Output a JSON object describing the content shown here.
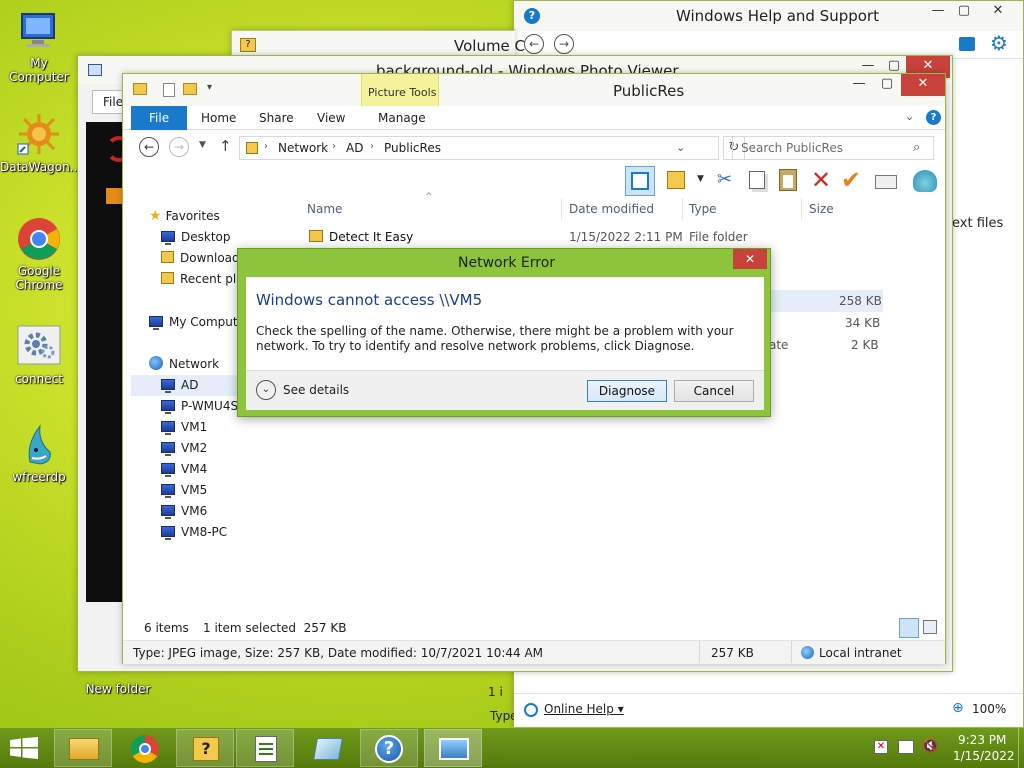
{
  "desktop": {
    "icons": [
      {
        "label": "My Computer"
      },
      {
        "label": "DataWagon..."
      },
      {
        "label": "Google Chrome"
      },
      {
        "label": "connect"
      },
      {
        "label": "wfreerdp"
      },
      {
        "label": "New folder"
      }
    ]
  },
  "help_window": {
    "title": "Windows Help and Support",
    "online_help": "Online Help",
    "zoom": "100%",
    "partial_text": "ext files",
    "partial_type": "Type",
    "partial_one": "1 i"
  },
  "volume_window": {
    "title": "Volume C"
  },
  "photo_viewer": {
    "title": "background-old - Windows Photo Viewer",
    "file_tab": "File"
  },
  "explorer": {
    "title": "PublicRes",
    "contextual_group": "Picture Tools",
    "ribbon_tabs": [
      "File",
      "Home",
      "Share",
      "View",
      "Manage"
    ],
    "breadcrumb": [
      "Network",
      "AD",
      "PublicRes"
    ],
    "search_placeholder": "Search PublicRes",
    "nav": {
      "favorites": "Favorites",
      "favorites_items": [
        "Desktop",
        "Downloads",
        "Recent places"
      ],
      "my_computer": "My Computer",
      "network": "Network",
      "network_items": [
        "AD",
        "P-WMU4S",
        "VM1",
        "VM2",
        "VM4",
        "VM5",
        "VM6",
        "VM8-PC"
      ]
    },
    "columns": [
      "Name",
      "Date modified",
      "Type",
      "Size"
    ],
    "rows": [
      {
        "name": "Detect It Easy",
        "date": "1/15/2022 2:11 PM",
        "type": "File folder",
        "size": ""
      },
      {
        "name": "",
        "date": "",
        "type": "",
        "size": "258 KB"
      },
      {
        "name": "",
        "date": "",
        "type": "",
        "size": "34 KB"
      },
      {
        "name": "",
        "date": "",
        "type": "ate",
        "size": "2 KB"
      }
    ],
    "status_items": "6 items",
    "status_selected": "1 item selected  257 KB",
    "details_bar": "Type: JPEG image, Size: 257 KB, Date modified: 10/7/2021 10:44 AM",
    "details_size": "257 KB",
    "details_zone": "Local intranet"
  },
  "dialog": {
    "title": "Network Error",
    "heading": "Windows cannot access \\\\VM5",
    "message": "Check the spelling of the name. Otherwise, there might be a problem with your network. To try to identify and resolve network problems, click Diagnose.",
    "see_details": "See details",
    "diagnose": "Diagnose",
    "cancel": "Cancel"
  },
  "taskbar": {
    "time": "9:23 PM",
    "date": "1/15/2022"
  },
  "colors": {
    "accent": "#1979ca",
    "dialog_border": "#8cc43c",
    "close_red": "#c7423a",
    "heading_blue": "#1a3e8c"
  }
}
